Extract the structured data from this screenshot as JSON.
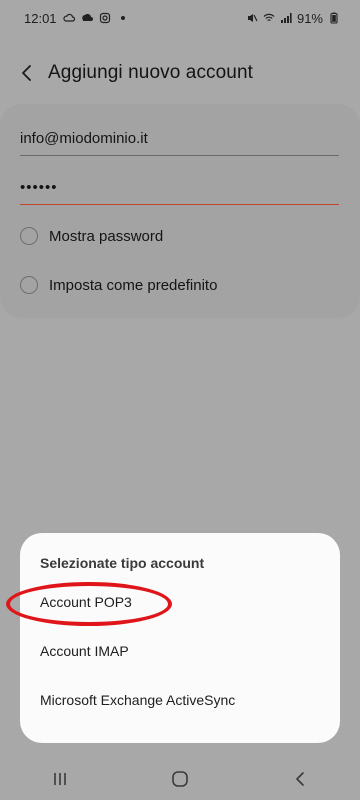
{
  "status_bar": {
    "time": "12:01",
    "battery": "91%",
    "icons": [
      "cloud-icon",
      "upload-icon",
      "instagram-icon",
      "dot-icon",
      "mute-icon",
      "wifi-icon",
      "signal-icon",
      "battery-icon"
    ]
  },
  "header": {
    "title": "Aggiungi nuovo account"
  },
  "form": {
    "email": "info@miodominio.it",
    "password_masked": "••••••",
    "show_password_label": "Mostra password",
    "default_label": "Imposta come predefinito"
  },
  "sheet": {
    "title": "Selezionate tipo account",
    "items": [
      "Account POP3",
      "Account IMAP",
      "Microsoft Exchange ActiveSync"
    ]
  },
  "colors": {
    "highlight": "#e0151a",
    "focus_underline": "#c0452a"
  }
}
